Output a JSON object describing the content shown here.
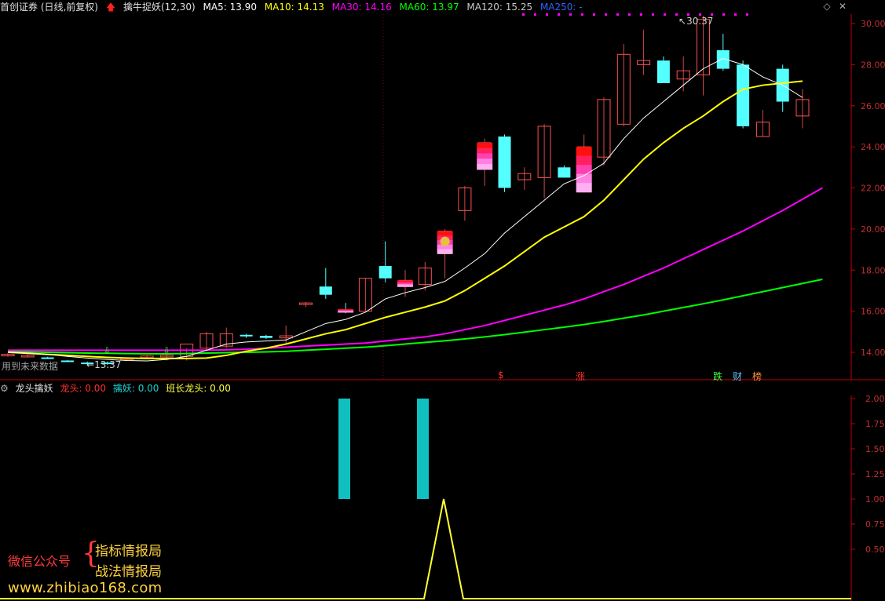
{
  "header": {
    "stock_title": "首创证券 (日线,前复权)",
    "indicator_name": "擒牛捉妖(12,30)",
    "ma5": "MA5: 13.90",
    "ma10": "MA10: 14.13",
    "ma30": "MA30: 14.16",
    "ma60": "MA60: 13.97",
    "ma120": "MA120: 15.25",
    "ma250": "MA250: -"
  },
  "colors": {
    "ma5": "#ffffff",
    "ma10": "#ffff00",
    "ma30": "#ff00ff",
    "ma60": "#00ff00",
    "ma120": "#c8c8c8",
    "ma250": "#0000ff",
    "up_candle": "#ff5050",
    "down_candle": "#54ffff",
    "axis": "#c00000"
  },
  "main_chart": {
    "y_ticks": [
      "30.00",
      "28.00",
      "26.00",
      "24.00",
      "22.00",
      "20.00",
      "18.00",
      "16.00",
      "14.00"
    ],
    "high_label": "30.37",
    "low_label": "13.37",
    "future_data_label": "用到未来数据",
    "event_labels": [
      {
        "text": "$",
        "color": "#ff3030",
        "key": "dollar"
      },
      {
        "text": "涨",
        "color": "#ff3030",
        "key": "zhang"
      },
      {
        "text": "跌",
        "color": "#40ff40",
        "key": "die"
      },
      {
        "text": "财",
        "color": "#60c0ff",
        "key": "cai"
      },
      {
        "text": "榜",
        "color": "#ff9040",
        "key": "bang"
      }
    ]
  },
  "sub_chart": {
    "title": "龙头擒妖",
    "longtou": "龙头: 0.00",
    "qinyao": "擒妖: 0.00",
    "banzhang": "班长龙头: 0.00",
    "y_ticks": [
      "2.00",
      "1.75",
      "1.50",
      "1.25",
      "1.00",
      "0.75",
      "0.50"
    ]
  },
  "watermark": {
    "account_label": "微信公众号",
    "line1": "指标情报局",
    "line2": "战法情报局",
    "url": "www.zhibiao168.com"
  },
  "chart_data": {
    "type": "candlestick",
    "ylim": [
      13.5,
      30.5
    ],
    "candles": [
      {
        "o": 13.85,
        "h": 13.95,
        "l": 13.8,
        "c": 13.9
      },
      {
        "o": 13.85,
        "h": 13.9,
        "l": 13.75,
        "c": 13.85
      },
      {
        "o": 13.75,
        "h": 13.78,
        "l": 13.7,
        "c": 13.72
      },
      {
        "o": 13.6,
        "h": 13.63,
        "l": 13.55,
        "c": 13.58
      },
      {
        "o": 13.5,
        "h": 13.55,
        "l": 13.37,
        "c": 13.45
      },
      {
        "o": 13.5,
        "h": 13.55,
        "l": 13.4,
        "c": 13.45
      },
      {
        "o": 13.7,
        "h": 13.75,
        "l": 13.65,
        "c": 13.72
      },
      {
        "o": 13.8,
        "h": 13.85,
        "l": 13.75,
        "c": 13.82
      },
      {
        "o": 13.8,
        "h": 13.9,
        "l": 13.6,
        "c": 13.85
      },
      {
        "o": 13.8,
        "h": 14.2,
        "l": 13.6,
        "c": 14.4
      },
      {
        "o": 14.2,
        "h": 15.0,
        "l": 14.1,
        "c": 14.9
      },
      {
        "o": 14.3,
        "h": 15.2,
        "l": 14.2,
        "c": 14.9
      },
      {
        "o": 14.85,
        "h": 14.9,
        "l": 14.7,
        "c": 14.8
      },
      {
        "o": 14.8,
        "h": 14.85,
        "l": 14.65,
        "c": 14.7
      },
      {
        "o": 14.7,
        "h": 15.3,
        "l": 14.45,
        "c": 14.8
      },
      {
        "o": 16.4,
        "h": 16.45,
        "l": 16.2,
        "c": 16.4
      },
      {
        "o": 17.2,
        "h": 18.1,
        "l": 16.6,
        "c": 16.8
      },
      {
        "o": 16.1,
        "h": 16.4,
        "l": 15.9,
        "c": 15.95
      },
      {
        "o": 16.0,
        "h": 17.6,
        "l": 16.0,
        "c": 17.6
      },
      {
        "o": 18.2,
        "h": 19.4,
        "l": 17.4,
        "c": 17.6
      },
      {
        "o": 17.2,
        "h": 18.0,
        "l": 16.7,
        "c": 17.5
      },
      {
        "o": 17.3,
        "h": 18.4,
        "l": 17.0,
        "c": 18.1
      },
      {
        "o": 18.8,
        "h": 20.0,
        "l": 17.6,
        "c": 19.9
      },
      {
        "o": 20.9,
        "h": 22.1,
        "l": 20.4,
        "c": 22.0
      },
      {
        "o": 22.9,
        "h": 24.4,
        "l": 22.1,
        "c": 24.2
      },
      {
        "o": 24.5,
        "h": 24.6,
        "l": 21.8,
        "c": 22.0
      },
      {
        "o": 22.4,
        "h": 23.0,
        "l": 21.9,
        "c": 22.7
      },
      {
        "o": 22.5,
        "h": 25.1,
        "l": 21.5,
        "c": 25.0
      },
      {
        "o": 23.0,
        "h": 23.1,
        "l": 22.5,
        "c": 22.5
      },
      {
        "o": 21.8,
        "h": 24.6,
        "l": 21.8,
        "c": 24.0
      },
      {
        "o": 23.5,
        "h": 26.4,
        "l": 23.1,
        "c": 26.3
      },
      {
        "o": 25.1,
        "h": 29.0,
        "l": 25.0,
        "c": 28.5
      },
      {
        "o": 28.0,
        "h": 29.7,
        "l": 27.5,
        "c": 28.2
      },
      {
        "o": 28.2,
        "h": 28.4,
        "l": 27.1,
        "c": 27.1
      },
      {
        "o": 27.3,
        "h": 28.4,
        "l": 26.7,
        "c": 27.7
      },
      {
        "o": 27.5,
        "h": 30.37,
        "l": 26.5,
        "c": 30.2
      },
      {
        "o": 28.7,
        "h": 29.5,
        "l": 27.7,
        "c": 27.8
      },
      {
        "o": 28.0,
        "h": 28.2,
        "l": 24.9,
        "c": 25.0
      },
      {
        "o": 24.5,
        "h": 25.8,
        "l": 24.5,
        "c": 25.2
      },
      {
        "o": 27.8,
        "h": 28.0,
        "l": 25.7,
        "c": 26.2
      },
      {
        "o": 25.5,
        "h": 26.8,
        "l": 24.9,
        "c": 26.3
      }
    ],
    "ma5_series": [
      14.0,
      13.95,
      13.9,
      13.8,
      13.72,
      13.65,
      13.6,
      13.58,
      13.65,
      13.8,
      14.1,
      14.4,
      14.5,
      14.55,
      14.6,
      15.0,
      15.4,
      15.6,
      15.95,
      16.6,
      16.9,
      17.15,
      17.45,
      18.1,
      18.8,
      19.8,
      20.6,
      21.4,
      22.2,
      22.6,
      23.2,
      24.4,
      25.4,
      26.2,
      27.0,
      27.8,
      28.3,
      28.0,
      27.4,
      27.0,
      26.4
    ],
    "ma10_series": [
      14.0,
      13.95,
      13.9,
      13.85,
      13.8,
      13.75,
      13.72,
      13.7,
      13.7,
      13.7,
      13.72,
      13.85,
      14.05,
      14.2,
      14.4,
      14.65,
      14.9,
      15.1,
      15.4,
      15.7,
      15.95,
      16.2,
      16.5,
      17.0,
      17.6,
      18.2,
      18.9,
      19.6,
      20.1,
      20.6,
      21.4,
      22.4,
      23.4,
      24.2,
      24.9,
      25.5,
      26.2,
      26.8,
      27.0,
      27.1,
      27.2
    ],
    "ma30_series": [
      14.1,
      14.1,
      14.1,
      14.1,
      14.1,
      14.1,
      14.1,
      14.1,
      14.1,
      14.1,
      14.1,
      14.12,
      14.15,
      14.2,
      14.25,
      14.3,
      14.35,
      14.4,
      14.45,
      14.55,
      14.65,
      14.75,
      14.9,
      15.1,
      15.3,
      15.55,
      15.8,
      16.05,
      16.3,
      16.6,
      16.95,
      17.3,
      17.7,
      18.1,
      18.55,
      19.0,
      19.45,
      19.9,
      20.4,
      20.9,
      21.45,
      22.0
    ],
    "ma60_series": [
      14.05,
      14.02,
      14.0,
      13.98,
      13.96,
      13.95,
      13.94,
      13.93,
      13.93,
      13.94,
      13.96,
      13.98,
      14.0,
      14.02,
      14.05,
      14.1,
      14.15,
      14.2,
      14.25,
      14.32,
      14.4,
      14.48,
      14.56,
      14.65,
      14.75,
      14.86,
      14.98,
      15.1,
      15.22,
      15.35,
      15.5,
      15.66,
      15.82,
      16.0,
      16.18,
      16.36,
      16.55,
      16.75,
      16.95,
      17.15,
      17.35,
      17.55
    ],
    "sub_qinyao_bars": [
      {
        "index": 17,
        "value": 1.0
      },
      {
        "index": 21,
        "value": 1.0
      }
    ],
    "sub_banzhang_line": {
      "peak_index": 22,
      "peak_value": 1.0
    }
  }
}
